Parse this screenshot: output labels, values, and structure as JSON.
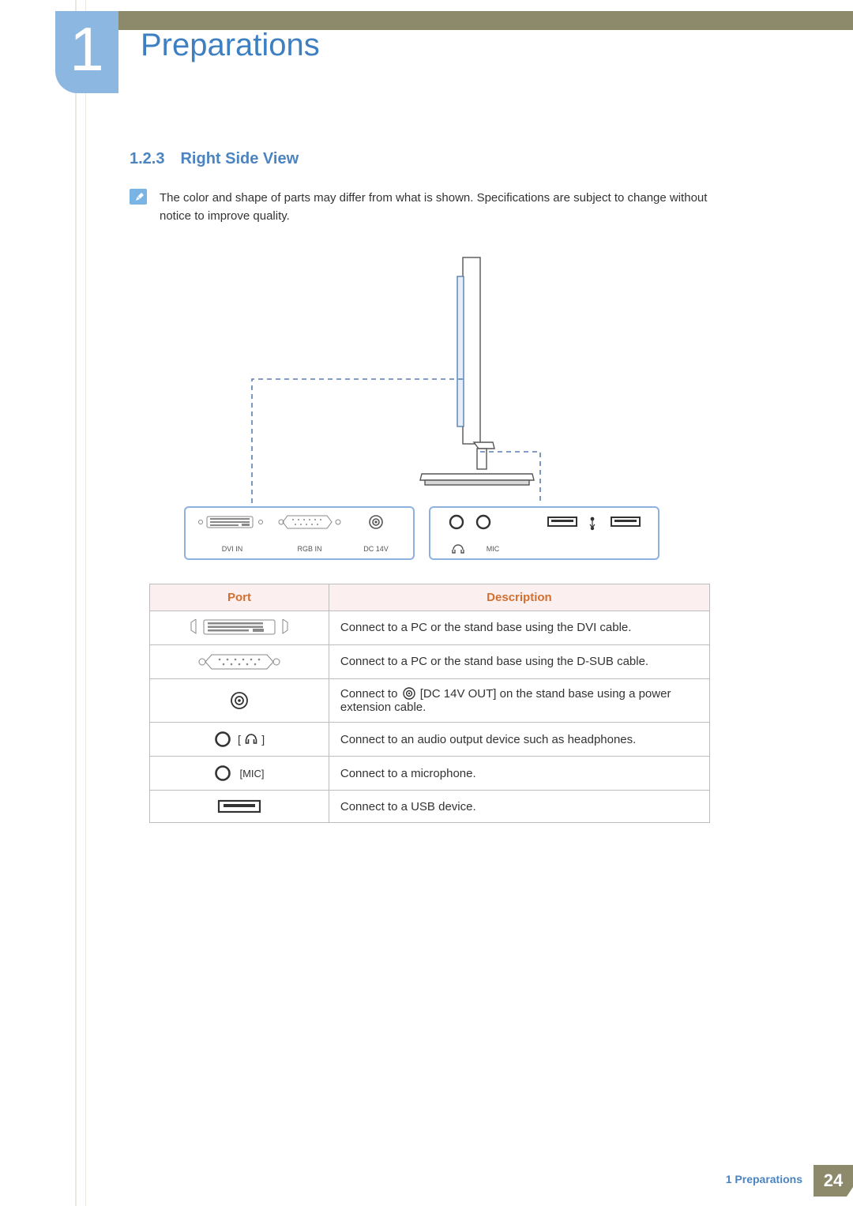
{
  "chapter": {
    "number": "1",
    "title": "Preparations"
  },
  "section": {
    "number": "1.2.3",
    "title": "Right Side View"
  },
  "note": "The color and shape of parts may differ from what is shown. Specifications are subject to change without notice to improve quality.",
  "diagram_labels": {
    "dvi_in": "DVI IN",
    "rgb_in": "RGB IN",
    "dc_14v": "DC 14V",
    "mic": "MIC"
  },
  "table": {
    "headers": {
      "port": "Port",
      "description": "Description"
    },
    "rows": [
      {
        "key": "dvi",
        "description": "Connect to a PC or the stand base using the DVI cable."
      },
      {
        "key": "dsub",
        "description": "Connect to a PC or the stand base using the D-SUB cable."
      },
      {
        "key": "dc",
        "desc_before": "Connect to ",
        "desc_middle": " [DC 14V OUT] on the stand base using a power extension cable."
      },
      {
        "key": "headphone",
        "description": "Connect to an audio output device such as headphones."
      },
      {
        "key": "mic",
        "port_label": "[MIC]",
        "description": "Connect to a microphone."
      },
      {
        "key": "usb",
        "description": "Connect to a USB device."
      }
    ]
  },
  "footer": {
    "chapter_ref": "1 Preparations",
    "page": "24"
  }
}
